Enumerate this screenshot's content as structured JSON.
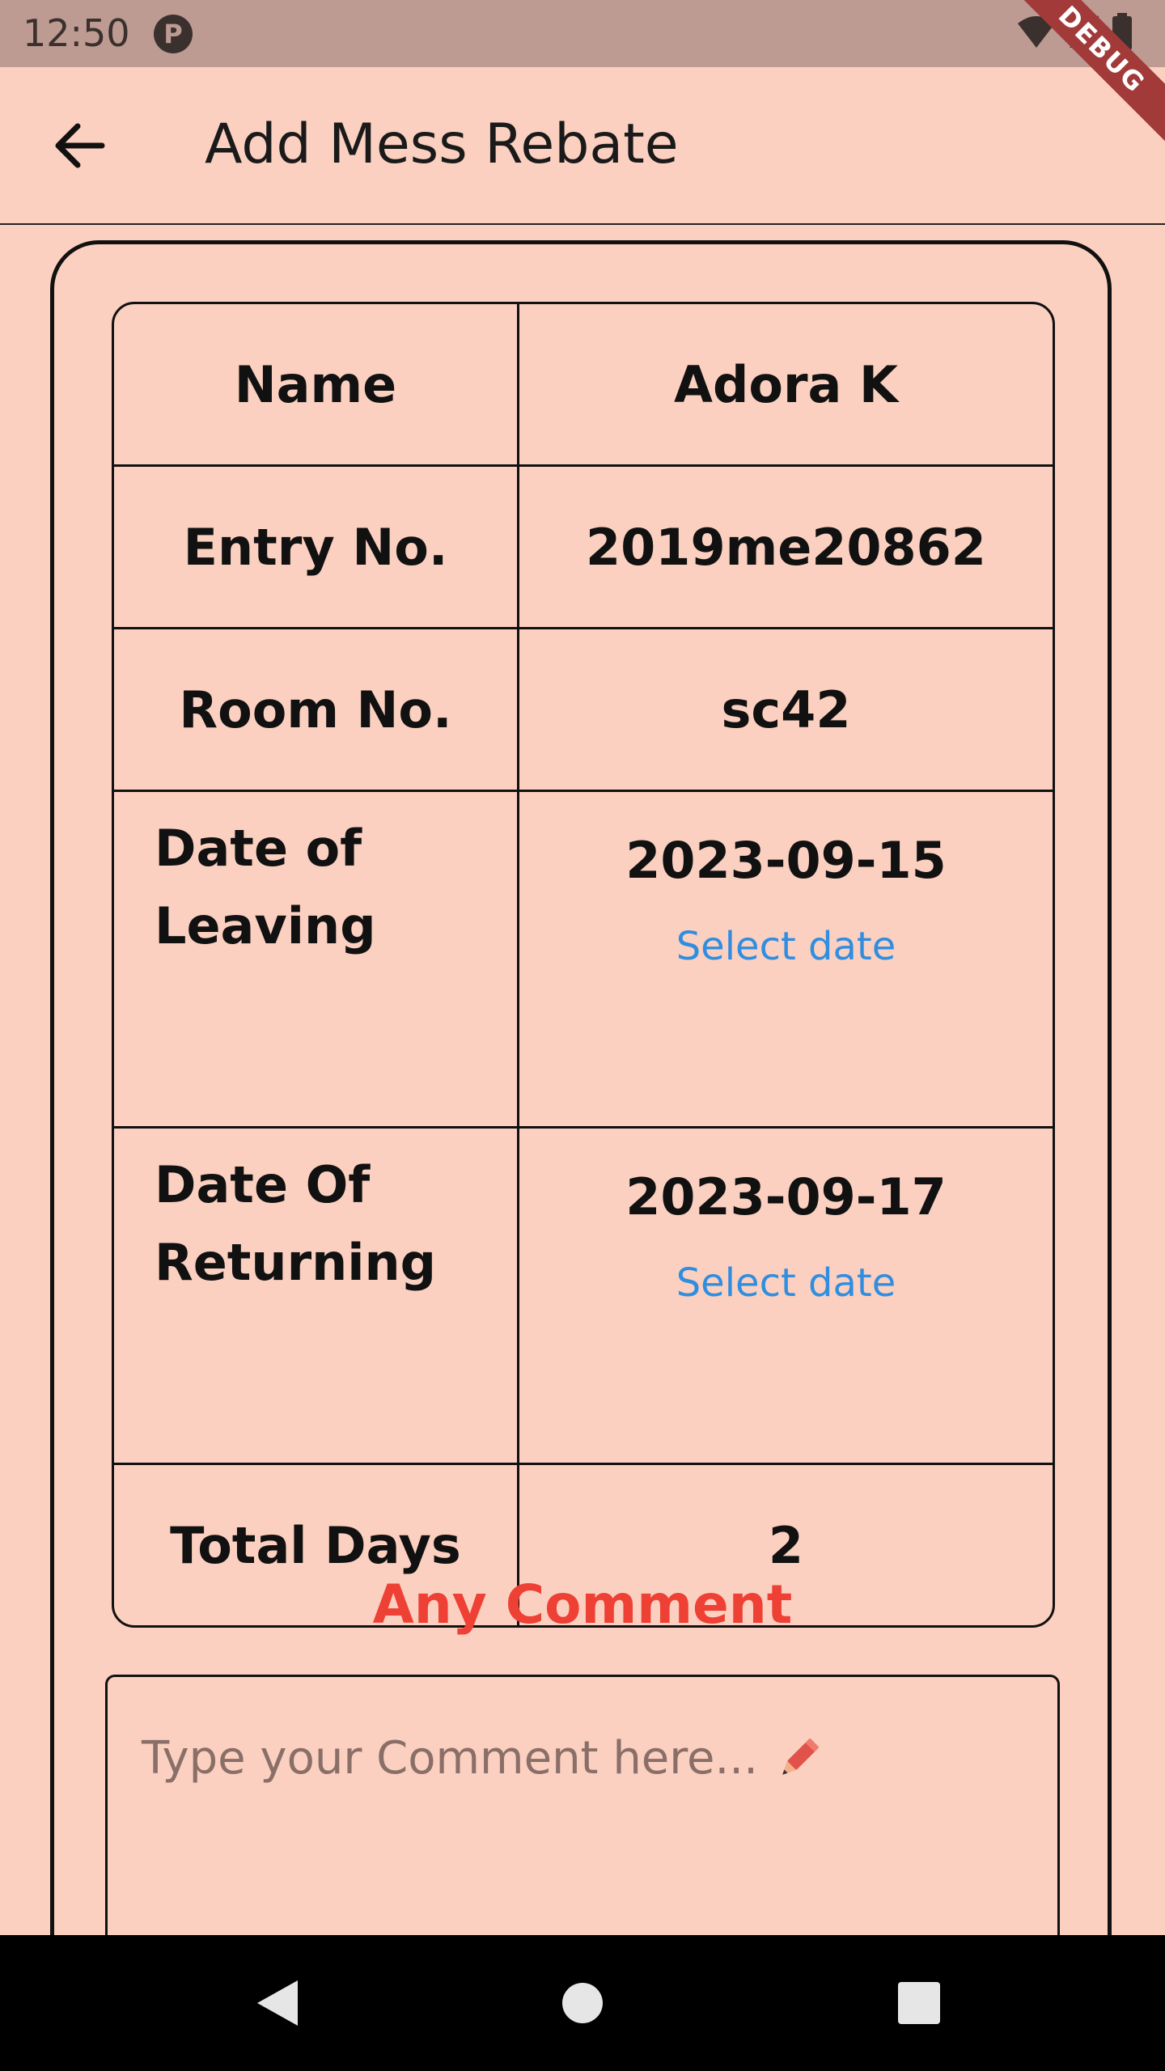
{
  "status_bar": {
    "time": "12:50",
    "app_icon_glyph": "P",
    "icons": [
      "wifi-icon",
      "signal-icon",
      "battery-icon"
    ]
  },
  "debug_banner": "DEBUG",
  "app_bar": {
    "title": "Add Mess Rebate",
    "back_icon": "arrow-back-icon"
  },
  "info_table": {
    "rows": [
      {
        "label": "Name",
        "value": "Adora K"
      },
      {
        "label": "Entry No.",
        "value": "2019me20862"
      },
      {
        "label": "Room No.",
        "value": "sc42"
      },
      {
        "label": "Date of Leaving",
        "value": "2023-09-15",
        "action": "Select date"
      },
      {
        "label": "Date Of Returning",
        "value": "2023-09-17",
        "action": "Select date"
      },
      {
        "label": "Total Days",
        "value": "2"
      }
    ]
  },
  "comment": {
    "heading": "Any Comment",
    "placeholder": "Type your Comment here...",
    "placeholder_icon": "pencil-icon"
  },
  "nav_bar": {
    "buttons": [
      "back-triangle-icon",
      "home-circle-icon",
      "recents-square-icon"
    ]
  },
  "colors": {
    "background": "#fbd0c0",
    "status_bar": "#bd9b92",
    "accent_link": "#2f8ee0",
    "comment_heading": "#ee4035",
    "debug_ribbon": "#a33a3a"
  }
}
